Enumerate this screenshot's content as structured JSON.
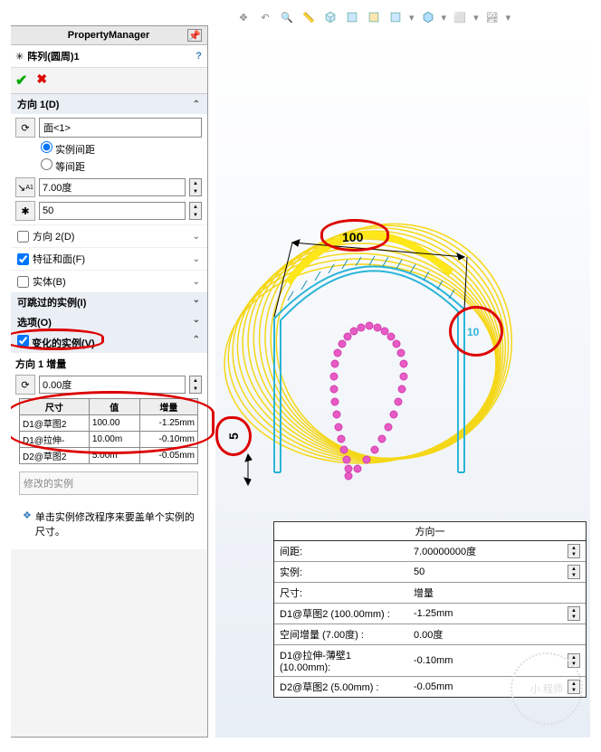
{
  "header": {
    "title": "PropertyManager",
    "feature_name": "阵列(圆周)1"
  },
  "direction1": {
    "title": "方向 1(D)",
    "selection": "面<1>",
    "spacing_mode_instance": "实例间距",
    "spacing_mode_equal": "等间距",
    "angle_value": "7.00度",
    "count_value": "50"
  },
  "checks": {
    "dir2": "方向 2(D)",
    "feat_face": "特征和面(F)",
    "bodies": "实体(B)"
  },
  "sections": {
    "skip": "可跳过的实例(I)",
    "options": "选项(O)",
    "varied": "变化的实例(V)"
  },
  "varied": {
    "increment_label": "方向 1 增量",
    "increment_value": "0.00度",
    "table": {
      "h1": "尺寸",
      "h2": "值",
      "h3": "增量",
      "rows": [
        {
          "dim": "D1@草图2",
          "val": "100.00",
          "inc": "-1.25mm"
        },
        {
          "dim": "D1@拉伸-",
          "val": "10.00m",
          "inc": "-0.10mm"
        },
        {
          "dim": "D2@草图2",
          "val": "5.00m",
          "inc": "-0.05mm"
        }
      ]
    },
    "modified_title": "修改的实例",
    "hint": "单击实例修改程序来要盖单个实例的尺寸。"
  },
  "viewport": {
    "dim100": "100",
    "dim10": "10",
    "dim5": "5"
  },
  "info": {
    "title": "方向一",
    "rows": [
      {
        "label": "间距:",
        "value": "7.00000000度",
        "spin": true
      },
      {
        "label": "实例:",
        "value": "50",
        "spin": true
      },
      {
        "label": "尺寸:",
        "value": "增量",
        "spin": false
      },
      {
        "label": "D1@草图2 (100.00mm) :",
        "value": "-1.25mm",
        "spin": true
      },
      {
        "label": "空间增量 (7.00度) :",
        "value": "0.00度",
        "spin": false
      },
      {
        "label": "D1@拉伸-薄壁1 (10.00mm):",
        "value": "-0.10mm",
        "spin": true
      },
      {
        "label": "D2@草图2 (5.00mm) :",
        "value": "-0.05mm",
        "spin": true
      }
    ]
  },
  "watermark": "小 程师"
}
